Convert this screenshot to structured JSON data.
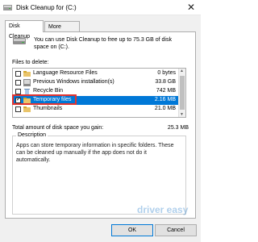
{
  "window": {
    "title": "Disk Cleanup for  (C:)",
    "close_glyph": "✕"
  },
  "tabs": [
    {
      "label": "Disk Cleanup"
    },
    {
      "label": "More Options"
    }
  ],
  "intro_text": "You can use Disk Cleanup to free up to 75.3 GB of disk space on  (C:).",
  "files_label": "Files to delete:",
  "files": [
    {
      "name": "Language Resource Files",
      "size": "0 bytes",
      "checked": false,
      "icon": "folder-icon"
    },
    {
      "name": "Previous Windows installation(s)",
      "size": "33.8 GB",
      "checked": false,
      "icon": "windows-icon"
    },
    {
      "name": "Recycle Bin",
      "size": "742 MB",
      "checked": false,
      "icon": "recycle-bin-icon"
    },
    {
      "name": "Temporary files",
      "size": "2.16 MB",
      "checked": true,
      "icon": "folder-icon"
    },
    {
      "name": "Thumbnails",
      "size": "21.0 MB",
      "checked": false,
      "icon": "folder-icon"
    }
  ],
  "total_label": "Total amount of disk space you gain:",
  "total_value": "25.3 MB",
  "description": {
    "title": "Description",
    "text": "Apps can store temporary information in specific folders. These can be cleaned up manually if the app does not do it automatically."
  },
  "buttons": {
    "ok": "OK",
    "cancel": "Cancel"
  },
  "watermark": "driver easy",
  "colors": {
    "selection": "#0078d7",
    "highlight_box": "#e3342f"
  }
}
